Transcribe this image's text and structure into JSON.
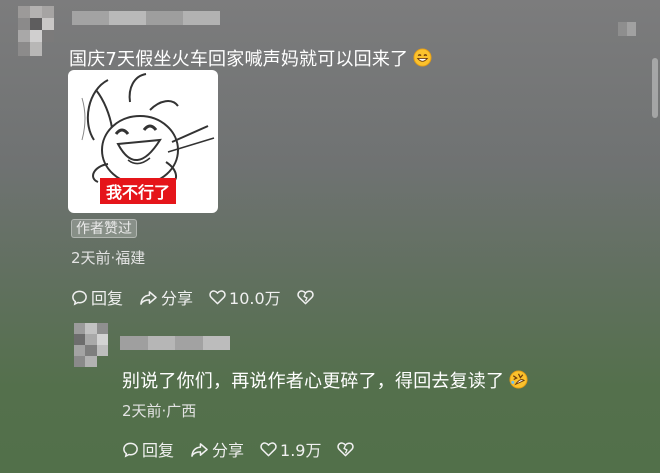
{
  "comment1": {
    "text": "国庆7天假坐火车回家喊声妈就可以回来了",
    "emoji": "grinning-face-emoji",
    "sticker_caption": "我不行了",
    "author_liked_badge": "作者赞过",
    "meta": "2天前·福建",
    "actions": {
      "reply": "回复",
      "share": "分享",
      "likes": "10.0万"
    }
  },
  "comment2": {
    "text": "别说了你们，再说作者心更碎了，得回去复读了",
    "emoji": "rolling-on-floor-laughing-emoji",
    "meta": "2天前·广西",
    "actions": {
      "reply": "回复",
      "share": "分享",
      "likes": "1.9万"
    }
  }
}
